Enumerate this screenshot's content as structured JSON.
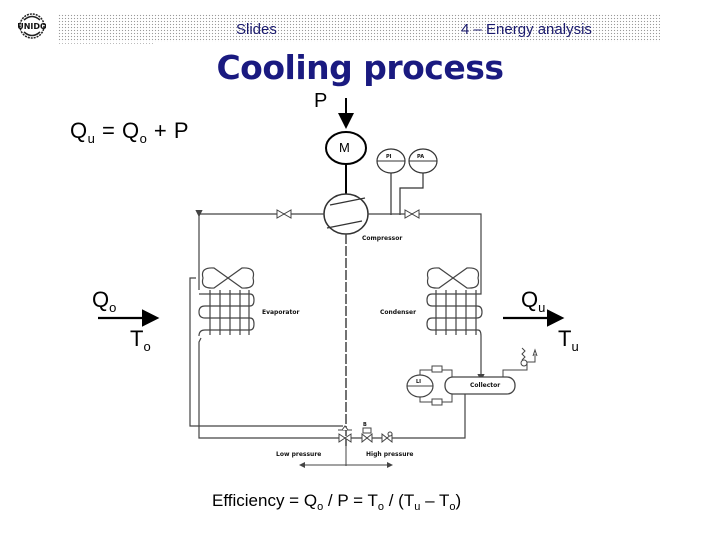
{
  "header": {
    "logo": "UNIDO",
    "left_label": "Slides",
    "right_label": "4 – Energy analysis"
  },
  "title": "Cooling process",
  "formula_top": {
    "lhs_q": "Q",
    "lhs_sub": "u",
    "eq": " = ",
    "rhs_q": "Q",
    "rhs_sub": "o",
    "plus_p": " + P"
  },
  "diagram": {
    "power_label": "P",
    "motor_label": "M",
    "gauge_left": "PI",
    "gauge_right": "PA",
    "compressor_label": "Compressor",
    "evaporator_label": "Evaporator",
    "condenser_label": "Condenser",
    "collector_label": "Collector",
    "sight_glass_label": "LI",
    "low_pressure_label": "Low pressure",
    "high_pressure_label": "High pressure",
    "valve_label": "B",
    "q_in": {
      "q": "Q",
      "sub": "o"
    },
    "t_in": {
      "t": "T",
      "sub": "o"
    },
    "q_out": {
      "q": "Q",
      "sub": "u"
    },
    "t_out": {
      "t": "T",
      "sub": "u"
    }
  },
  "efficiency": {
    "label": "Efficiency = ",
    "q": "Q",
    "q_sub": "o",
    "mid1": " / P = ",
    "t1": "T",
    "t1_sub": "o",
    "mid2": " / (",
    "t2": "T",
    "t2_sub": "u",
    "mid3": " – ",
    "t3": "T",
    "t3_sub": "o",
    "end": ")"
  },
  "colors": {
    "header_text": "#1a1a6e",
    "title": "#1a1a80"
  }
}
